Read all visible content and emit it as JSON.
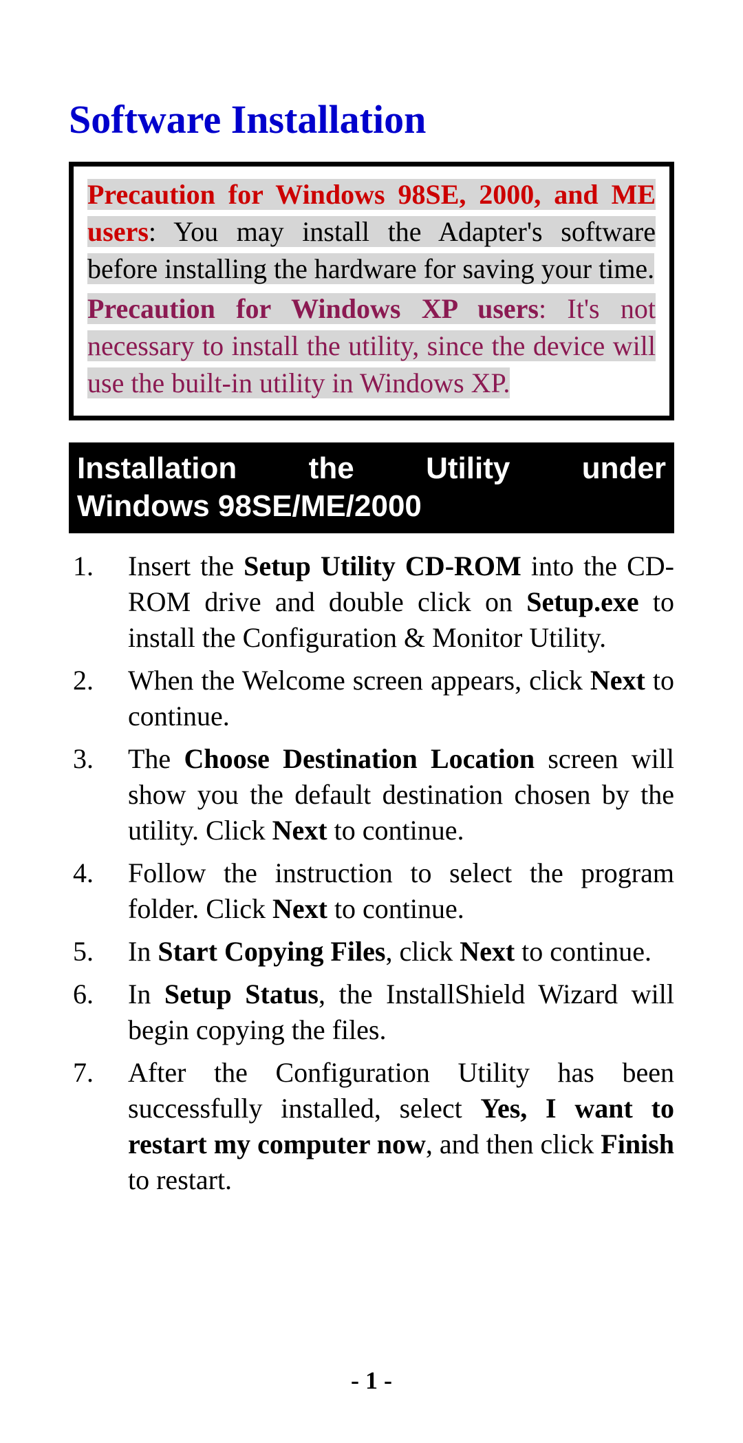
{
  "title": "Software Installation",
  "precaution1": {
    "label": "Precaution for Windows 98SE, 2000, and ME users",
    "text": ": You may install the Adapter's software before installing the hardware for saving your time."
  },
  "precaution2": {
    "label": "Precaution for Windows XP users",
    "text": ": It's not necessary to install the utility, since the device will use the built-in utility in Windows XP."
  },
  "section_header_line1": "Installation the Utility under",
  "section_header_line2": "Windows 98SE/ME/2000",
  "steps": {
    "s1_a": "Insert the ",
    "s1_b": "Setup Utility CD-ROM",
    "s1_c": " into the CD-ROM drive and double click on ",
    "s1_d": "Setup.exe",
    "s1_e": " to install the Configuration & Monitor Utility.",
    "s2_a": "When the Welcome screen appears, click ",
    "s2_b": "Next",
    "s2_c": " to continue.",
    "s3_a": "The ",
    "s3_b": "Choose Destination Location",
    "s3_c": " screen will show you the default destination chosen by the utility. Click ",
    "s3_d": "Next",
    "s3_e": " to continue.",
    "s4_a": "Follow the instruction to select the program folder. Click ",
    "s4_b": "Next",
    "s4_c": " to continue.",
    "s5_a": "In ",
    "s5_b": "Start Copying Files",
    "s5_c": ", click ",
    "s5_d": "Next",
    "s5_e": " to continue.",
    "s6_a": "In ",
    "s6_b": "Setup Status",
    "s6_c": ", the InstallShield Wizard will begin copying the files.",
    "s7_a": "After the Configuration Utility has been successfully installed, select ",
    "s7_b": "Yes, I want to restart my computer now",
    "s7_c": ", and then click ",
    "s7_d": "Finish",
    "s7_e": " to restart."
  },
  "page_number": "- 1 -"
}
